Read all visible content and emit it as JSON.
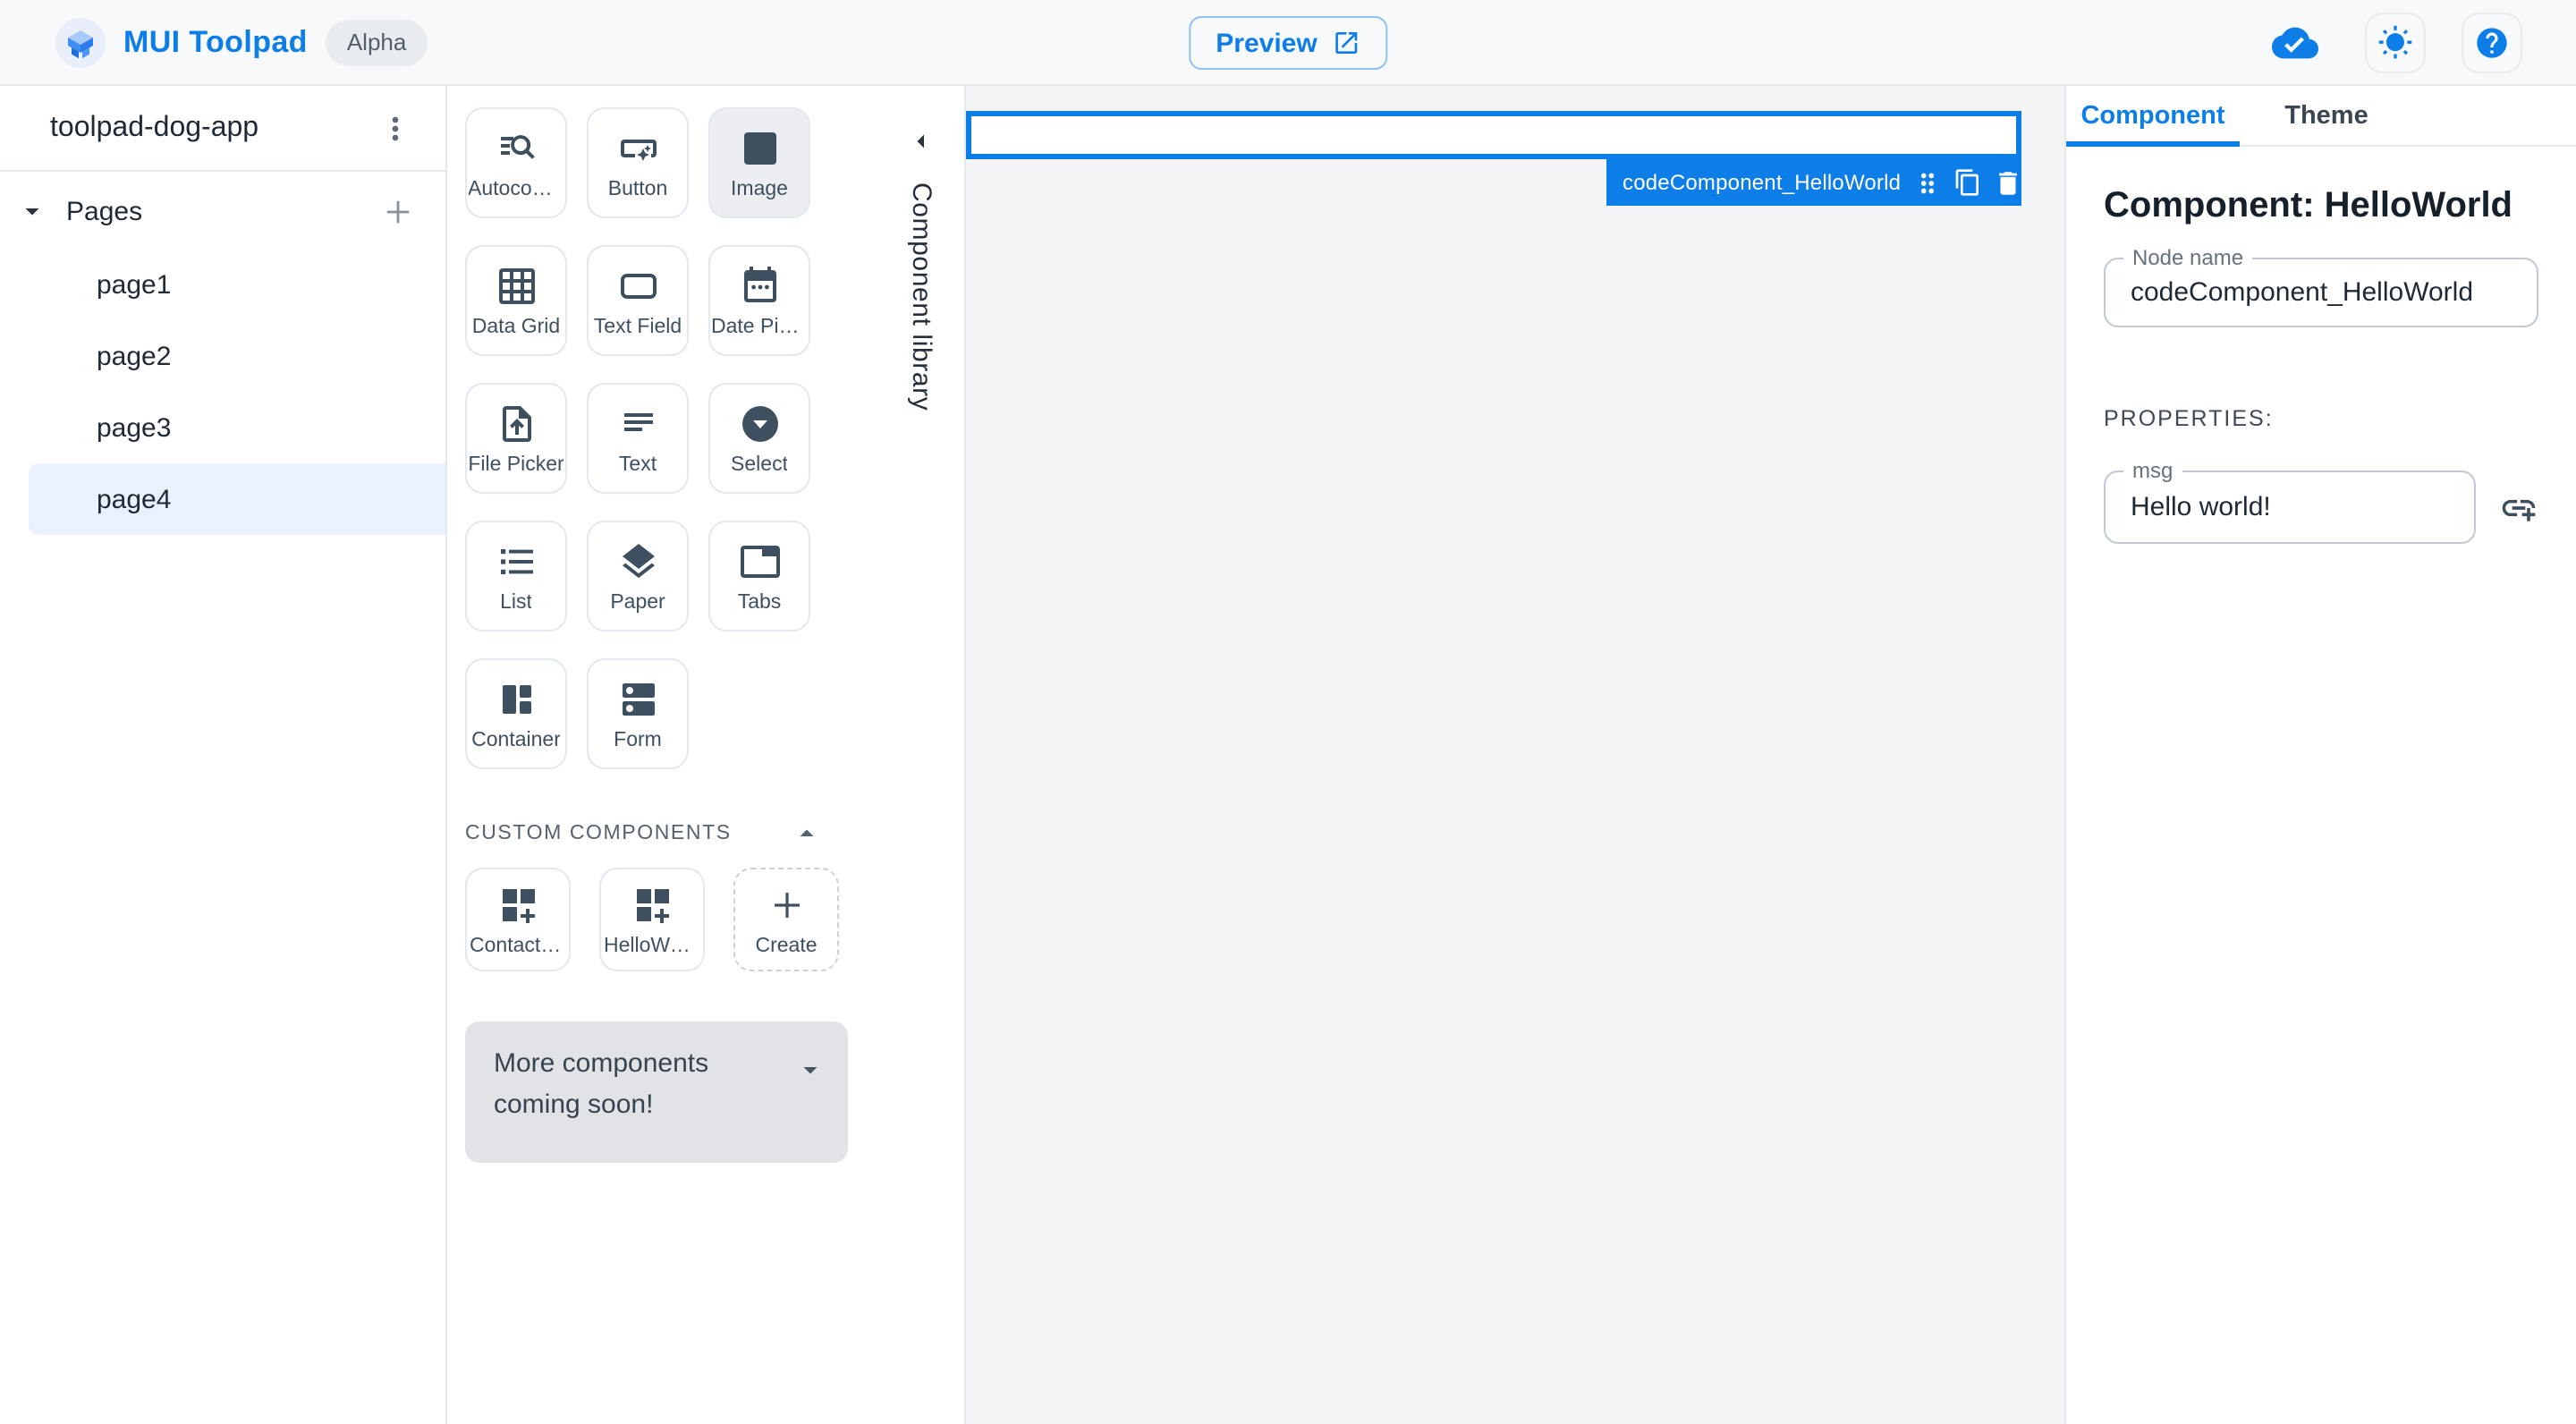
{
  "colors": {
    "primary_blue": "#0D7DE8",
    "header_bg": "#F8F9FB",
    "canvas_bg": "#F4F5F7",
    "divider": "#E5E8EC",
    "text_primary": "#1F2933",
    "text_secondary": "#3E5060",
    "active_page_bg": "#E9F2FC",
    "banner_bg": "#E1E3E7"
  },
  "header": {
    "app_title": "MUI Toolpad",
    "version_badge": "Alpha",
    "preview_label": "Preview"
  },
  "sidebar": {
    "project_name": "toolpad-dog-app",
    "pages_section_label": "Pages",
    "pages": [
      "page1",
      "page2",
      "page3",
      "page4"
    ],
    "active_page": "page4"
  },
  "library": {
    "panel_title": "Component library",
    "components": [
      {
        "label": "Autocomplete",
        "icon": "autocomplete-icon"
      },
      {
        "label": "Button",
        "icon": "smart-button-icon"
      },
      {
        "label": "Image",
        "icon": "image-icon"
      },
      {
        "label": "Data Grid",
        "icon": "grid-icon"
      },
      {
        "label": "Text Field",
        "icon": "textfield-icon"
      },
      {
        "label": "Date Picker",
        "icon": "calendar-icon"
      },
      {
        "label": "File Picker",
        "icon": "upload-file-icon"
      },
      {
        "label": "Text",
        "icon": "text-lines-icon"
      },
      {
        "label": "Select",
        "icon": "dropdown-circle-icon"
      },
      {
        "label": "List",
        "icon": "list-icon"
      },
      {
        "label": "Paper",
        "icon": "layers-icon"
      },
      {
        "label": "Tabs",
        "icon": "tab-icon"
      },
      {
        "label": "Container",
        "icon": "container-icon"
      },
      {
        "label": "Form",
        "icon": "form-icon"
      }
    ],
    "selected_component": "Image",
    "custom_section_label": "CUSTOM COMPONENTS",
    "custom_components": [
      {
        "label": "ContactSta…",
        "icon": "dashboard-customize-icon"
      },
      {
        "label": "HelloWorld",
        "icon": "dashboard-customize-icon"
      }
    ],
    "create_label": "Create",
    "banner_text": "More components coming soon!"
  },
  "canvas": {
    "selected_node_label": "codeComponent_HelloWorld"
  },
  "inspector": {
    "tabs": [
      {
        "label": "Component",
        "active": true
      },
      {
        "label": "Theme",
        "active": false
      }
    ],
    "heading": "Component: HelloWorld",
    "node_name_field": {
      "label": "Node name",
      "value": "codeComponent_HelloWorld"
    },
    "properties_heading": "PROPERTIES:",
    "msg_field": {
      "label": "msg",
      "value": "Hello world!"
    }
  }
}
